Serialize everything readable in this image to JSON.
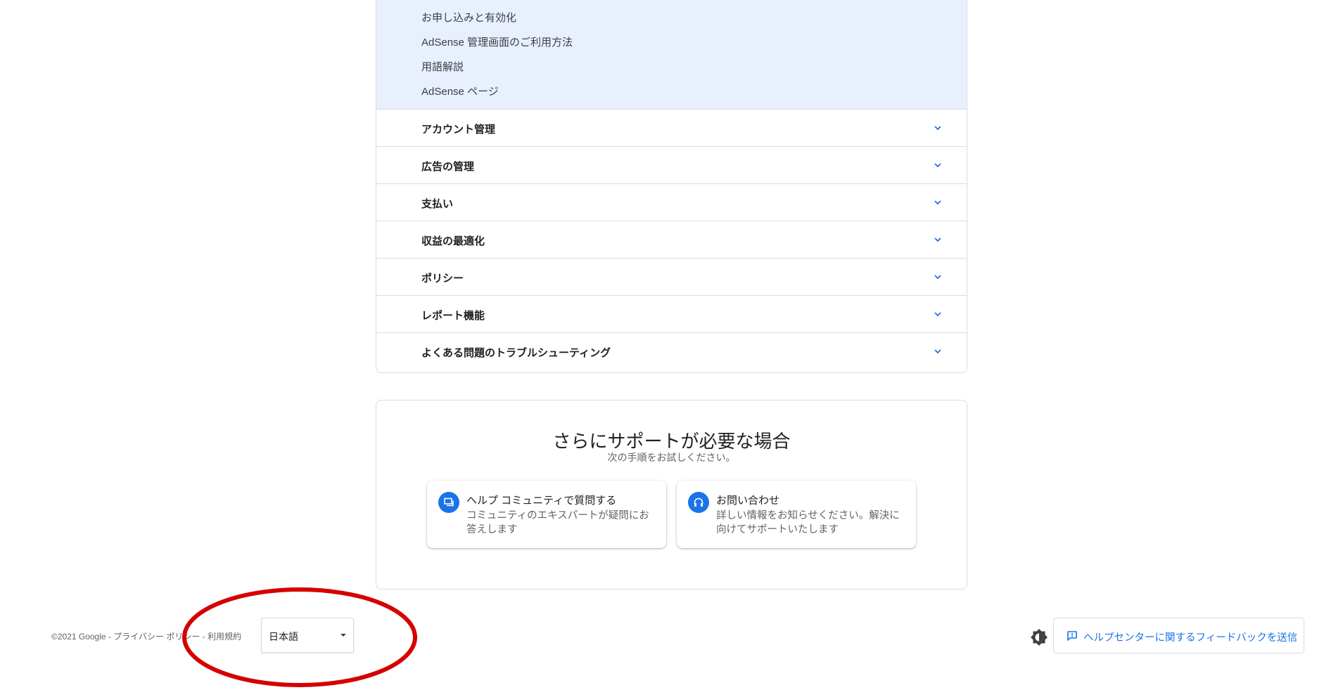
{
  "submenu": {
    "links": [
      "お申し込みと有効化",
      "AdSense 管理画面のご利用方法",
      "用語解説",
      "AdSense ページ"
    ]
  },
  "accordion": {
    "sections": [
      "アカウント管理",
      "広告の管理",
      "支払い",
      "収益の最適化",
      "ポリシー",
      "レポート機能",
      "よくある問題のトラブルシューティング"
    ]
  },
  "support": {
    "title": "さらにサポートが必要な場合",
    "subtitle": "次の手順をお試しください。",
    "options": [
      {
        "title": "ヘルプ コミュニティで質問する",
        "description": "コミュニティのエキスパートが疑問にお答えします",
        "icon": "forum-icon"
      },
      {
        "title": "お問い合わせ",
        "description": "詳しい情報をお知らせください。解決に向けてサポートいたします",
        "icon": "headset-icon"
      }
    ]
  },
  "footer": {
    "copyright": "©2021 Google - プライバシー ポリシー - 利用規約",
    "language": "日本語",
    "feedback_label": "ヘルプセンターに関するフィードバックを送信"
  },
  "colors": {
    "accent": "#1a73e8",
    "submenu_bg": "#e8f0fe",
    "annotation": "#d50000"
  }
}
